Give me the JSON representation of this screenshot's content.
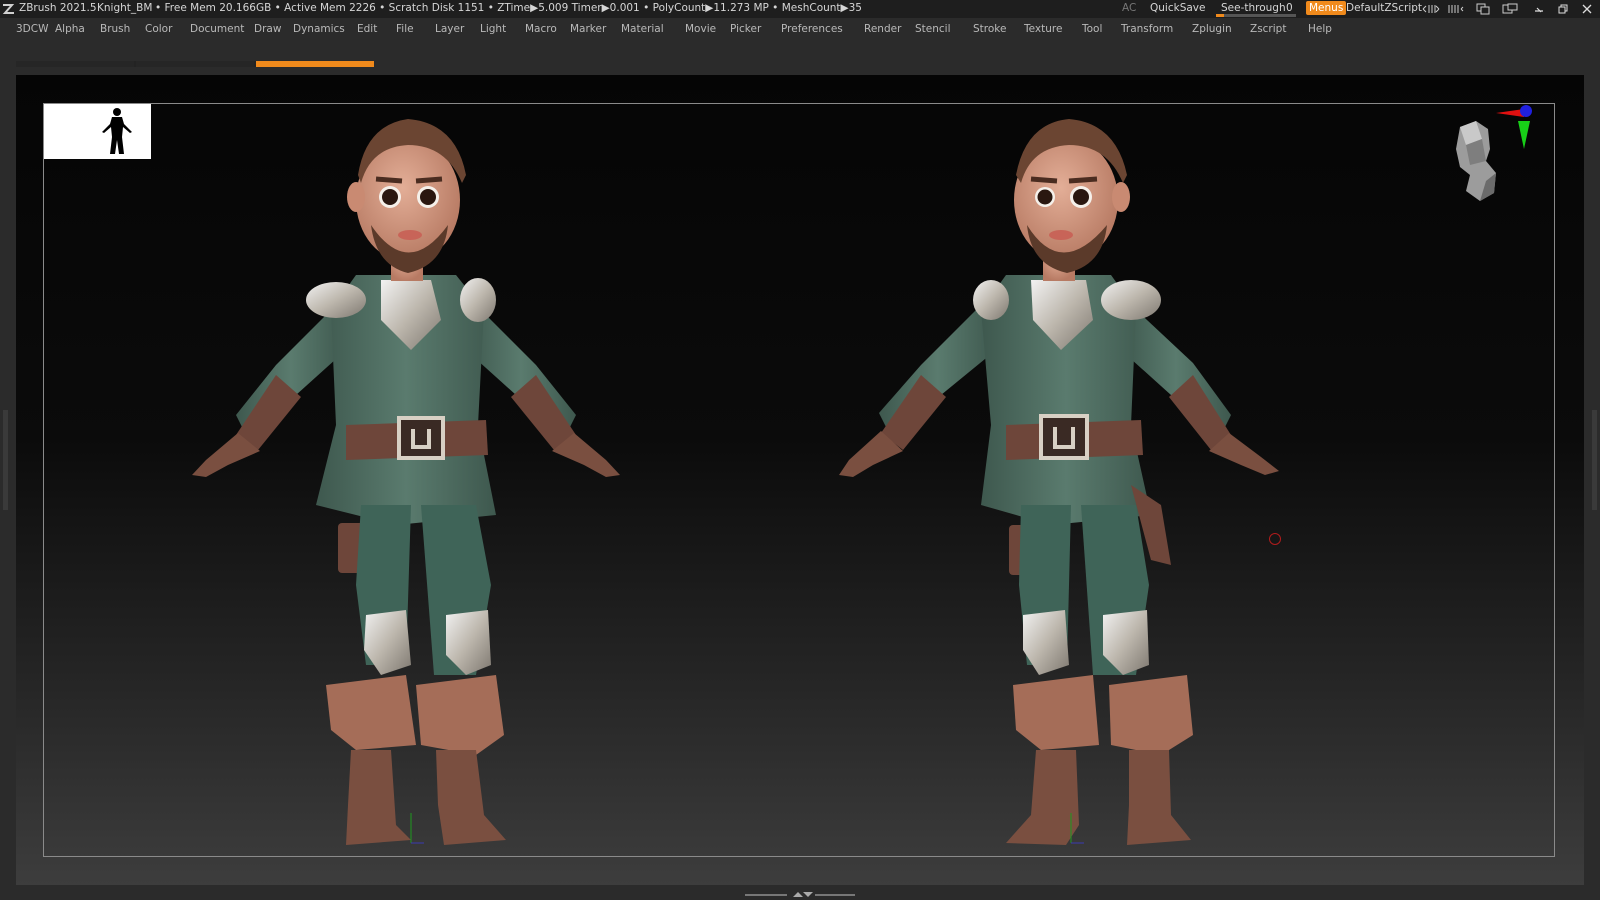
{
  "titlebar": {
    "app": "ZBrush 2021.5",
    "document": "Knight_BM",
    "stats": "• Free Mem 20.166GB • Active Mem 2226 • Scratch Disk 1151 • ZTime▶5.009 Timer▶0.001 • PolyCount▶11.273 MP • MeshCount▶35",
    "ac": "AC",
    "quicksave": "QuickSave",
    "see_through_label": "See-through",
    "see_through_value": "0",
    "see_through_level": 0,
    "menus_button": "Menus",
    "script": "DefaultZScript"
  },
  "menus": [
    "3DCW",
    "Alpha",
    "Brush",
    "Color",
    "Document",
    "Draw",
    "Dynamics",
    "Edit",
    "File",
    "Layer",
    "Light",
    "Macro",
    "Marker",
    "Material",
    "Movie",
    "Picker",
    "Preferences",
    "Render",
    "Stencil",
    "Stroke",
    "Texture",
    "Tool",
    "Transform",
    "Zplugin",
    "Zscript",
    "Help"
  ],
  "icons": {
    "logo": "zbrush-logo-icon",
    "minimize": "minimize-icon",
    "restore": "restore-icon",
    "close": "close-icon"
  },
  "colors": {
    "accent": "#f08a1c",
    "title_bg": "#1e1e1e",
    "ui_bg": "#2b2b2b",
    "cloth": "#4f6e62",
    "leather": "#6e463a",
    "skin": "#d79a84",
    "metal": "#cfcfcf",
    "axis_x": "#e01010",
    "axis_y": "#18d018",
    "axis_z": "#2020e0"
  }
}
